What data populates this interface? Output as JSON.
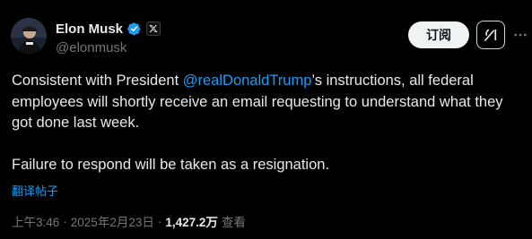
{
  "author": {
    "display_name": "Elon Musk",
    "handle": "@elonmusk",
    "verified_badge": "verified-check-icon",
    "affiliate_badge": "x-logo-icon"
  },
  "actions": {
    "subscribe_label": "订阅",
    "grok_icon": "grok-icon",
    "more_icon": "more-dots-icon"
  },
  "post": {
    "paragraph1_before": "Consistent with President ",
    "mention": "@realDonaldTrump",
    "paragraph1_after": "’s instructions, all federal employees will shortly receive an email requesting to understand what they got done last week.",
    "paragraph2": "Failure to respond will be taken as a resignation."
  },
  "translate": {
    "label": "翻译帖子"
  },
  "meta": {
    "time": "上午3:46",
    "date": "2025年2月23日",
    "separator": "·",
    "views_count": "1,427.2万",
    "views_label": "查看"
  },
  "colors": {
    "background": "#000000",
    "text": "#e7e9ea",
    "secondary": "#71767b",
    "link": "#1d9bf0",
    "button_bg": "#eff3f4"
  }
}
